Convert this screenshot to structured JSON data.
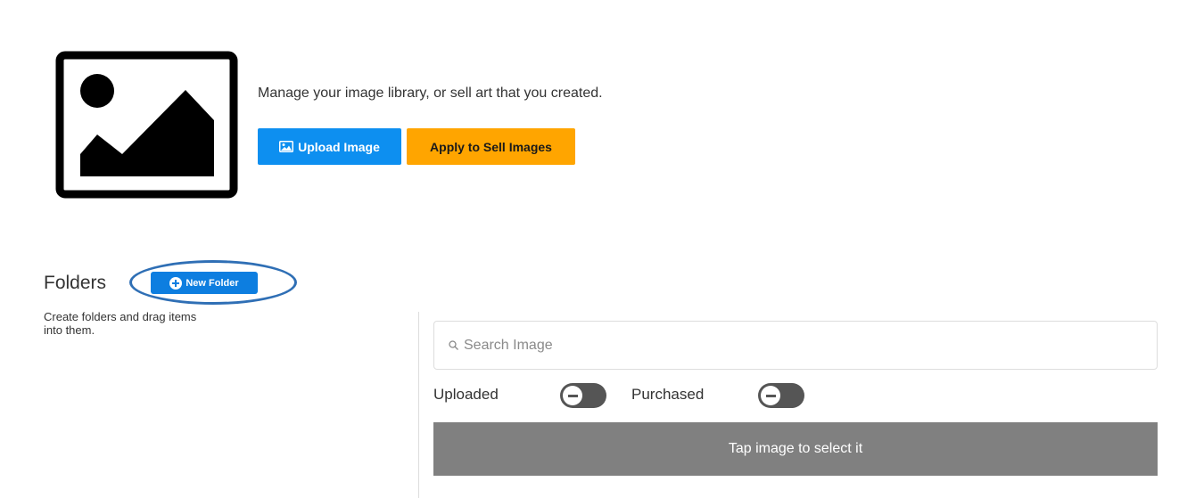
{
  "header": {
    "tagline": "Manage your image library, or sell art that you created.",
    "upload_label": "Upload Image",
    "sell_label": "Apply to Sell Images",
    "upload_color": "#0d8ff0",
    "sell_color": "#ffa500"
  },
  "folders": {
    "title": "Folders",
    "new_folder_label": "New Folder",
    "description": "Create folders and drag items into them."
  },
  "search": {
    "placeholder": "Search Image",
    "value": ""
  },
  "filters": [
    {
      "label": "Uploaded",
      "state": "off"
    },
    {
      "label": "Purchased",
      "state": "off"
    }
  ],
  "banner": {
    "text": "Tap image to select it"
  },
  "icons": {
    "hero": "image-placeholder-icon",
    "upload": "image-upload-icon",
    "new_folder": "plus-circle-icon",
    "search": "search-icon",
    "toggle": "minus-icon"
  }
}
